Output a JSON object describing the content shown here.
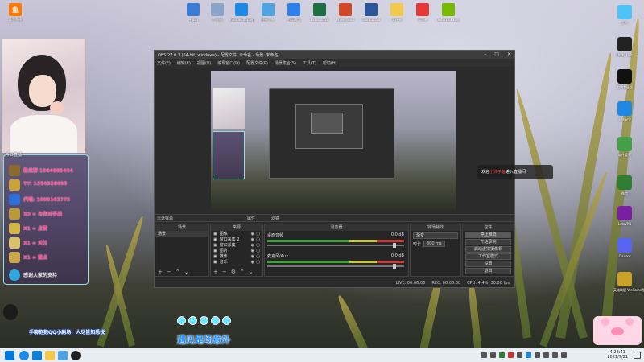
{
  "desktop": {
    "top_icons": [
      {
        "label": "计算机",
        "icon": "computer-icon",
        "color": "#3a7bd5"
      },
      {
        "label": "回收站",
        "icon": "recycle-bin-icon",
        "color": "#8aa4c8"
      },
      {
        "label": "Internet Explorer",
        "icon": "ie-icon",
        "color": "#1e88e5"
      },
      {
        "label": "控制面板",
        "icon": "control-panel-icon",
        "color": "#4fa3e0"
      },
      {
        "label": "百度网盘",
        "icon": "netdisk-icon",
        "color": "#2f80ed"
      },
      {
        "label": "Excel 2016",
        "icon": "excel-icon",
        "color": "#1d7044"
      },
      {
        "label": "PowerPoint",
        "icon": "powerpoint-icon",
        "color": "#d24726"
      },
      {
        "label": "Word 2016",
        "icon": "word-icon",
        "color": "#2b579a"
      },
      {
        "label": "文件夹",
        "icon": "folder-icon",
        "color": "#f2c94c"
      },
      {
        "label": "华为云",
        "icon": "huawei-icon",
        "color": "#e53935"
      },
      {
        "label": "GeForce Experience",
        "icon": "geforce-icon",
        "color": "#76b900"
      }
    ],
    "left_top_icon": {
      "label": "斗鱼直播",
      "icon": "douyu-icon",
      "color": "#ff7a00"
    },
    "right_icons": [
      {
        "label": "天气",
        "icon": "weather-icon",
        "color": "#4fc3f7"
      },
      {
        "label": "Unity Hub",
        "icon": "unity-icon",
        "color": "#222222"
      },
      {
        "label": "剪映专业版",
        "icon": "capcut-icon",
        "color": "#111111"
      },
      {
        "label": "火绒安全",
        "icon": "security-shield-icon",
        "color": "#1e88e5"
      },
      {
        "label": "软件管家",
        "icon": "app-store-icon",
        "color": "#43a047"
      },
      {
        "label": "微信",
        "icon": "wechat-icon",
        "color": "#2e7d32"
      },
      {
        "label": "LetsVPN",
        "icon": "vpn-icon",
        "color": "#7b1fa2"
      },
      {
        "label": "Discord",
        "icon": "discord-icon",
        "color": "#5865f2"
      },
      {
        "label": "英雄联盟 WeGame版",
        "icon": "lol-icon",
        "color": "#c9a227"
      }
    ]
  },
  "info_panel": {
    "badge": "今日直播",
    "rows": [
      "粉丝群 1064985454",
      "YY: 1354328093",
      "代唱: 1093163775",
      "X3 = 与你对手战",
      "X1 = 点赞",
      "X1 = 关注",
      "X1 = 整点",
      "感谢大家的支持"
    ]
  },
  "obs": {
    "title": "OBS 27.0.1 (64-bit, windows) - 配置文件: 未命名 - 场景: 未命名",
    "menu": [
      "文件(F)",
      "编辑(E)",
      "视图(V)",
      "停靠窗口(D)",
      "配置文件(P)",
      "场景集合(S)",
      "工具(T)",
      "帮助(H)"
    ],
    "dock_tabs": [
      "未选择源",
      "属性",
      "滤镜"
    ],
    "panels": {
      "scenes": {
        "title": "场景",
        "items": [
          "场景"
        ]
      },
      "sources": {
        "title": "来源",
        "items": [
          "图像",
          "窗口采集 2",
          "窗口采集",
          "图片",
          "媒体",
          "音乐"
        ]
      },
      "mixer": {
        "title": "混音器",
        "tracks": [
          {
            "name": "桌面音频",
            "level": "0.0 dB"
          },
          {
            "name": "麦克风/Aux",
            "level": "0.0 dB"
          }
        ]
      },
      "transitions": {
        "title": "转场特效",
        "type": "渐变",
        "duration_label": "时长",
        "duration": "300 ms"
      },
      "controls": {
        "title": "控件",
        "buttons": [
          "停止推流",
          "开始录制",
          "启动虚拟摄像机",
          "工作室模式",
          "设置",
          "退出"
        ]
      }
    },
    "status": {
      "live": "LIVE: 00:00:00",
      "rec": "REC: 00:00:00",
      "cpu": "CPU: 4.4%, 30.00 fps"
    }
  },
  "toast": {
    "prefix": "欢迎",
    "user": "小沐子鱼",
    "suffix": "进入直播间"
  },
  "overlay": {
    "subtitle": "遇见是场意外",
    "scroller": "手聊抱抱QQ小剧场：人尽皆知悉悦"
  },
  "taskbar": {
    "time": "4:23:41",
    "date": "2021/7/21"
  }
}
